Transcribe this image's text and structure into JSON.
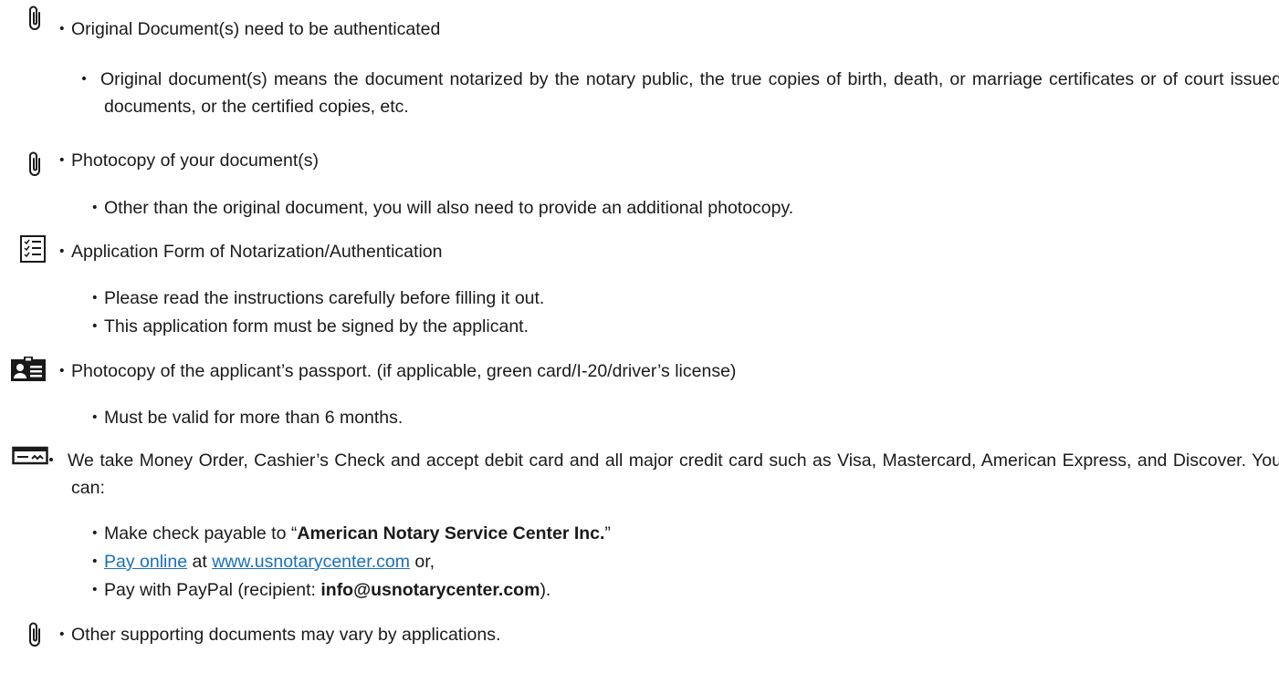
{
  "bullet": "・",
  "items": [
    {
      "icon": "paperclip-icon",
      "title": "Original Document(s) need to be authenticated",
      "subitems": [
        "Original document(s) means the document notarized by the notary public, the true copies of birth, death, or marriage certificates or of court issued documents, or the certified copies, etc."
      ]
    },
    {
      "icon": "paperclip-icon",
      "title": "Photocopy of your document(s)",
      "subitems": [
        "Other than the original document, you will also need to provide an additional photocopy."
      ]
    },
    {
      "icon": "checklist-icon",
      "title": "Application Form of Notarization/Authentication",
      "subitems": [
        "Please read the instructions carefully before filling it out.",
        "This application form must be signed by the applicant."
      ]
    },
    {
      "icon": "id-card-icon",
      "title": "Photocopy of the applicant’s passport. (if applicable, green card/I-20/driver’s license)",
      "subitems": [
        "Must be valid for more than 6 months."
      ]
    },
    {
      "icon": "check-payment-icon",
      "title": "We take Money Order, Cashier’s Check and accept debit card and all major credit card such as Visa, Mastercard, American Express, and Discover. You can:",
      "payment": {
        "check_prefix": "Make check payable to “",
        "check_payee": "American Notary Service Center Inc.",
        "check_suffix": "”",
        "online_link": "Pay online",
        "online_at": " at ",
        "online_site": "www.usnotarycenter.com",
        "online_suffix": " or,",
        "paypal_prefix": "Pay with PayPal (recipient: ",
        "paypal_email": "info@usnotarycenter.com",
        "paypal_suffix": ")."
      }
    },
    {
      "icon": "paperclip-icon",
      "title": "Other supporting documents may vary by applications.",
      "subitems": []
    }
  ],
  "colors": {
    "text": "#1a1a1a",
    "link": "#1a6fbf"
  }
}
